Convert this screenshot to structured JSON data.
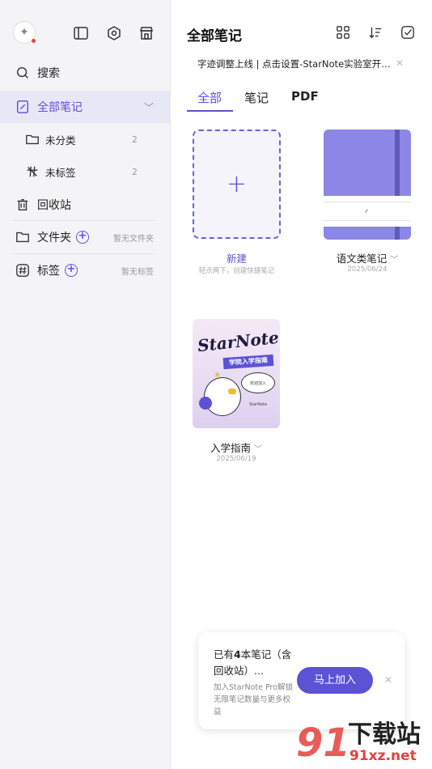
{
  "sidebar": {
    "top_icons": [
      "sparkle-icon",
      "sidebar-toggle-icon",
      "settings-hex-icon",
      "store-icon"
    ],
    "search_label": "搜索",
    "all_notes_label": "全部笔记",
    "uncategorized": {
      "label": "未分类",
      "count": "2"
    },
    "untagged": {
      "label": "未标签",
      "count": "2"
    },
    "trash_label": "回收站",
    "folders": {
      "label": "文件夹",
      "hint": "暂无文件夹"
    },
    "tags": {
      "label": "标签",
      "hint": "暂无标签"
    }
  },
  "main": {
    "title": "全部笔记",
    "header_icons": [
      "grid-view-icon",
      "sort-icon",
      "select-icon"
    ],
    "notice": "字迹调整上线 | 点击设置-StarNote实验室开…",
    "tabs": [
      {
        "label": "全部",
        "active": true
      },
      {
        "label": "笔记",
        "active": false
      },
      {
        "label": "PDF",
        "active": false
      }
    ],
    "new_card": {
      "label": "新建",
      "sub": "轻点两下，创建快捷笔记"
    },
    "notebooks": [
      {
        "label": "语文类笔记",
        "date": "2025/06/24"
      },
      {
        "label": "入学指南",
        "date": "2025/06/19",
        "cover_brand": "StarNote",
        "cover_ribbon": "学院入学指南",
        "cover_bubble": "欢迎加入StarNote"
      }
    ]
  },
  "promo": {
    "title_pre": "已有",
    "title_num": "4",
    "title_post": "本笔记（含回收站）...",
    "desc": "加入StarNote Pro解锁无限笔记数量与更多权益",
    "button": "马上加入"
  },
  "watermark": {
    "num": "91",
    "cn": "下载站",
    "url": "91xz.net"
  },
  "colors": {
    "accent": "#5b52d6",
    "sidebar_bg": "#f4f4f6",
    "notebook_cover": "#8c86e6"
  }
}
